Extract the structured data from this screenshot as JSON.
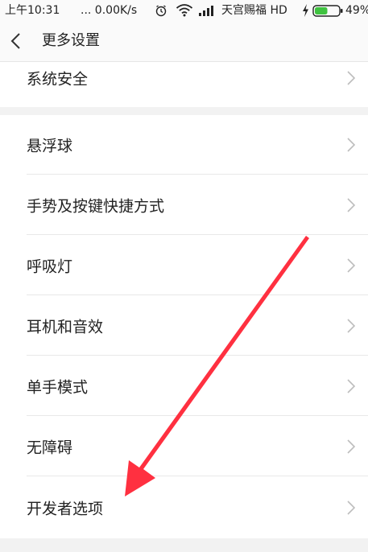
{
  "status_bar": {
    "time": "上午10:31",
    "speed": "... 0.00K/s",
    "carrier": "天宫赐福 HD",
    "battery": "49%",
    "icons": [
      "alarm-icon",
      "wifi-icon",
      "signal-icon",
      "charging-icon",
      "battery-icon"
    ]
  },
  "header": {
    "back_icon": "chevron-left-icon",
    "title": "更多设置"
  },
  "settings": {
    "top_item": "系统安全",
    "items": [
      "悬浮球",
      "手势及按键快捷方式",
      "呼吸灯",
      "耳机和音效",
      "单手模式",
      "无障碍",
      "开发者选项"
    ]
  },
  "annotation": {
    "color": "#ff3040",
    "target": "开发者选项"
  },
  "colors": {
    "background": "#f2f2f2",
    "card": "#ffffff",
    "text": "#222222",
    "chevron": "#bdbdbd",
    "battery_green": "#3fc240"
  }
}
